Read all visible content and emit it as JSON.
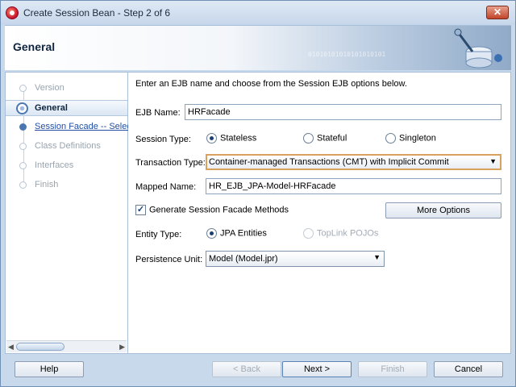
{
  "window": {
    "title": "Create Session Bean - Step 2 of 6",
    "close_glyph": "✕"
  },
  "header": {
    "title": "General",
    "art_text": "01010101010101010101"
  },
  "steps": [
    {
      "label": "Version",
      "state": "done"
    },
    {
      "label": "General",
      "state": "active"
    },
    {
      "label": "Session Facade -- Select",
      "state": "link"
    },
    {
      "label": "Class Definitions",
      "state": "pending"
    },
    {
      "label": "Interfaces",
      "state": "pending"
    },
    {
      "label": "Finish",
      "state": "pending"
    }
  ],
  "form": {
    "intro": "Enter an EJB name and choose from the Session EJB options below.",
    "ejb_name_label": "EJB Name:",
    "ejb_name_value": "HRFacade",
    "session_type_label": "Session Type:",
    "session_types": {
      "stateless": "Stateless",
      "stateful": "Stateful",
      "singleton": "Singleton",
      "selected": "Stateless"
    },
    "transaction_type_label": "Transaction Type:",
    "transaction_type_value": "Container-managed Transactions (CMT) with Implicit Commit",
    "mapped_name_label": "Mapped Name:",
    "mapped_name_value": "HR_EJB_JPA-Model-HRFacade",
    "generate_facade_label": "Generate Session Facade Methods",
    "generate_facade_checked": true,
    "more_options_label": "More Options",
    "entity_type_label": "Entity Type:",
    "entity_types": {
      "jpa": "JPA Entities",
      "toplink": "TopLink POJOs",
      "selected": "JPA Entities"
    },
    "persistence_unit_label": "Persistence Unit:",
    "persistence_unit_value": "Model (Model.jpr)"
  },
  "footer": {
    "help": "Help",
    "back": "< Back",
    "next": "Next >",
    "finish": "Finish",
    "cancel": "Cancel"
  },
  "icons": {
    "dropdown": "▼",
    "check": "✓",
    "scroll_left": "◀",
    "scroll_right": "▶"
  }
}
